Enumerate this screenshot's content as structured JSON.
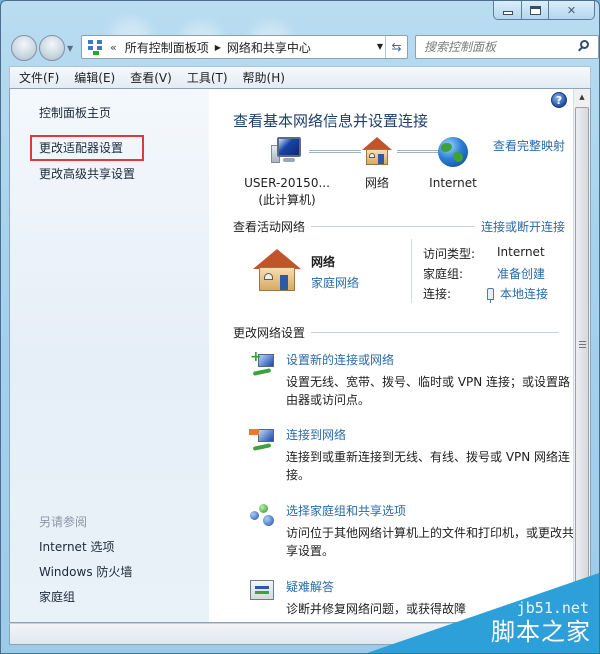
{
  "window": {
    "caption_buttons": {
      "minimize": "minimize",
      "maximize": "maximize",
      "close": "close"
    }
  },
  "navigation": {
    "address": {
      "overflow_chevron": "«",
      "segments": [
        "所有控制面板项",
        "网络和共享中心"
      ],
      "separator": "▶"
    },
    "search": {
      "placeholder": "搜索控制面板"
    }
  },
  "menu": {
    "items": [
      "文件(F)",
      "编辑(E)",
      "查看(V)",
      "工具(T)",
      "帮助(H)"
    ]
  },
  "sidebar": {
    "links": [
      "控制面板主页",
      "更改适配器设置",
      "更改高级共享设置"
    ],
    "highlighted_index": 1,
    "see_also_heading": "另请参阅",
    "see_also": [
      "Internet 选项",
      "Windows 防火墙",
      "家庭组"
    ]
  },
  "main": {
    "help_icon": "?",
    "title": "查看基本网络信息并设置连接",
    "full_map_link": "查看完整映射",
    "diagram": {
      "computer": {
        "line1": "USER-20150...",
        "line2": "(此计算机)"
      },
      "network": {
        "label": "网络"
      },
      "internet": {
        "label": "Internet"
      }
    },
    "active_networks": {
      "heading": "查看活动网络",
      "connect_link": "连接或断开连接",
      "network_name": "网络",
      "network_type": "家庭网络",
      "rows": [
        {
          "label": "访问类型:",
          "value": "Internet",
          "is_link": false
        },
        {
          "label": "家庭组:",
          "value": "准备创建",
          "is_link": true
        },
        {
          "label": "连接:",
          "value": "本地连接",
          "is_link": true
        }
      ]
    },
    "change_settings": {
      "heading": "更改网络设置",
      "tasks": [
        {
          "icon": "new-connection-icon",
          "link": "设置新的连接或网络",
          "desc": "设置无线、宽带、拨号、临时或 VPN 连接；或设置路由器或访问点。"
        },
        {
          "icon": "connect-network-icon",
          "link": "连接到网络",
          "desc": "连接到或重新连接到无线、有线、拨号或 VPN 网络连接。"
        },
        {
          "icon": "homegroup-icon",
          "link": "选择家庭组和共享选项",
          "desc": "访问位于其他网络计算机上的文件和打印机，或更改共享设置。"
        },
        {
          "icon": "troubleshoot-icon",
          "link": "疑难解答",
          "desc": "诊断并修复网络问题，或获得故障"
        }
      ]
    }
  },
  "watermark": {
    "site": "jb51.net",
    "brand": "脚本之家",
    "color": "#2d9fd9"
  },
  "colors": {
    "link": "#2a6aa8",
    "title": "#1e3f6b",
    "highlight_border": "#e0393c"
  }
}
